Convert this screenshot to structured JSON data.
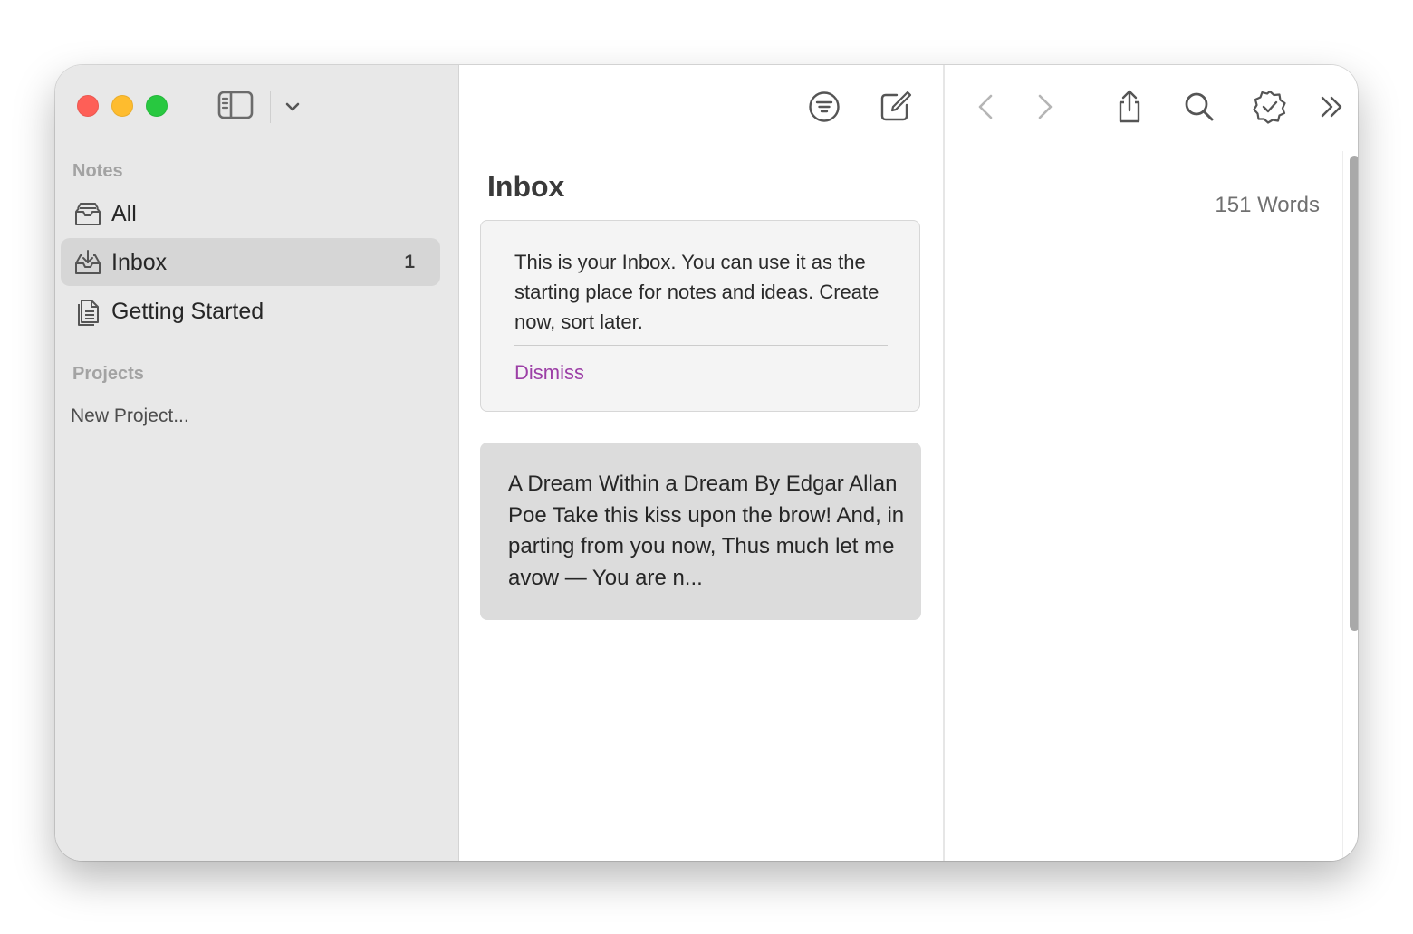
{
  "sidebar": {
    "notes_heading": "Notes",
    "items": [
      {
        "label": "All",
        "icon": "tray-stack-icon"
      },
      {
        "label": "Inbox",
        "count": "1",
        "icon": "inbox-tray-icon",
        "selected": true
      },
      {
        "label": "Getting Started",
        "icon": "document-icon"
      }
    ],
    "projects_heading": "Projects",
    "new_project_label": "New Project..."
  },
  "list": {
    "title": "Inbox",
    "callout": {
      "text": "This is your Inbox. You can use it as the starting place for notes and ideas. Create now, sort later.",
      "dismiss_label": "Dismiss"
    },
    "notes": [
      {
        "snippet": "A Dream Within a Dream By Edgar Allan Poe Take this kiss upon the brow! And, in parting from you now, Thus much let me avow — You are n..."
      }
    ]
  },
  "editor": {
    "word_count": "151 Words"
  },
  "colors": {
    "sidebar_bg": "#e8e8e8",
    "selected_row": "#d6d6d6",
    "accent_link": "#9c3fa6",
    "close": "#fe5f57",
    "minimize": "#febc2e",
    "zoom": "#28c840"
  }
}
